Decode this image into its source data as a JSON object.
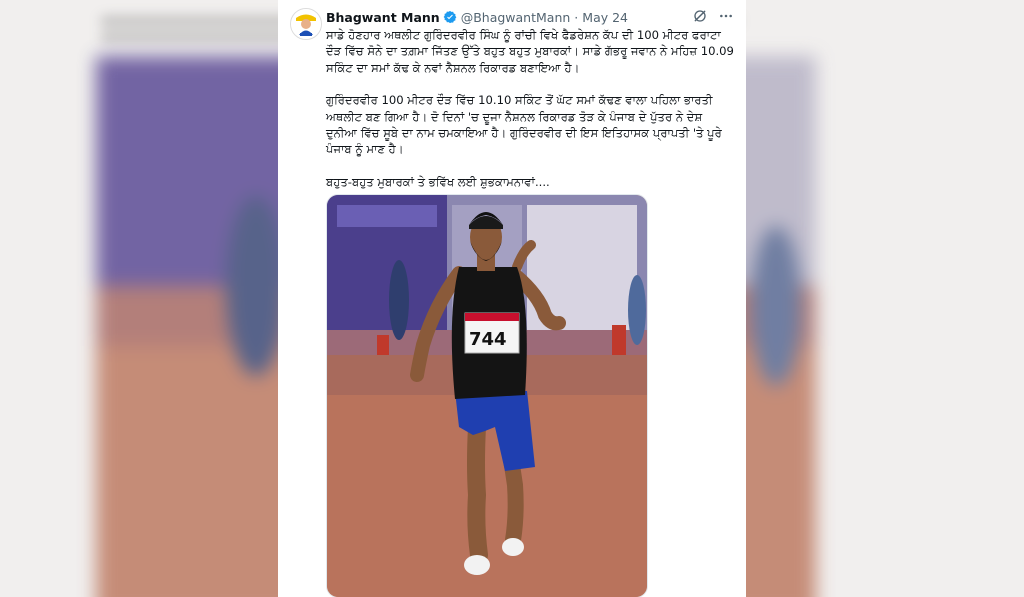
{
  "tweet": {
    "author_name": "Bhagwant Mann",
    "handle": "@BhagwantMann",
    "separator": "·",
    "date": "May 24",
    "paragraphs": [
      "ਸਾਡੇ ਹੋਣਹਾਰ ਅਥਲੀਟ ਗੁਰਿੰਦਰਵੀਰ ਸਿੰਘ ਨੂੰ ਰਾਂਚੀ ਵਿਖੇ ਫੈਡਰੇਸ਼ਨ ਕੱਪ ਦੀ 100 ਮੀਟਰ ਫਰਾਟਾ ਦੌੜ ਵਿੱਚ ਸੋਨੇ ਦਾ ਤਗ਼ਮਾ ਜਿੱਤਣ ਉੱਤੇ ਬਹੁਤ ਬਹੁਤ ਮੁਬਾਰਕਾਂ। ਸਾਡੇ ਗੱਭਰੂ ਜਵਾਨ ਨੇ ਮਹਿਜ਼ 10.09 ਸਕਿੰਟ ਦਾ ਸਮਾਂ ਕੱਢ ਕੇ ਨਵਾਂ ਨੈਸ਼ਨਲ ਰਿਕਾਰਡ ਬਣਾਇਆ ਹੈ।",
      "ਗੁਰਿੰਦਰਵੀਰ 100 ਮੀਟਰ ਦੌੜ ਵਿੱਚ 10.10 ਸਕਿੰਟ ਤੋਂ ਘੱਟ ਸਮਾਂ ਕੱਢਣ ਵਾਲਾ ਪਹਿਲਾ ਭਾਰਤੀ ਅਥਲੀਟ ਬਣ ਗਿਆ ਹੈ। ਦੋ ਦਿਨਾਂ 'ਚ ਦੂਜਾ ਨੈਸ਼ਨਲ ਰਿਕਾਰਡ ਤੋੜ ਕੇ ਪੰਜਾਬ ਦੇ ਪੁੱਤਰ ਨੇ ਦੇਸ਼ ਦੁਨੀਆ ਵਿੱਚ ਸੂਬੇ ਦਾ ਨਾਮ ਚਮਕਾਇਆ ਹੈ। ਗੁਰਿੰਦਰਵੀਰ ਦੀ ਇਸ ਇਤਿਹਾਸਕ ਪ੍ਰਾਪਤੀ 'ਤੇ ਪੂਰੇ ਪੰਜਾਬ ਨੂੰ ਮਾਣ ਹੈ।",
      "ਬਹੁਤ-ਬਹੁਤ ਮੁਬਾਰਕਾਂ ਤੇ ਭਵਿੱਖ ਲਈ ਸ਼ੁਭਕਾਮਨਾਵਾਂ...."
    ],
    "bib_number": "744"
  },
  "icons": {
    "verified": "verified-badge-icon",
    "grok": "grok-icon",
    "more": "more-options-icon"
  },
  "colors": {
    "verified_blue": "#1d9bf0",
    "text_primary": "#0f1419",
    "text_secondary": "#536471",
    "track": "#b4725c",
    "singlet": "#141414",
    "shorts": "#1f3fb0"
  }
}
